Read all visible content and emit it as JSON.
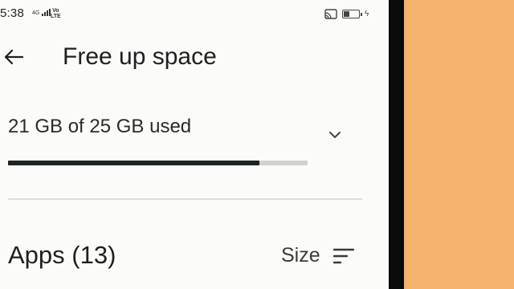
{
  "status_bar": {
    "time": "5:38",
    "network": "4G",
    "volte_line1": "Vo",
    "volte_line2": "LTE",
    "battery_level": 0.45
  },
  "app_bar": {
    "back_icon": "arrow-back-icon",
    "title": "Free up space"
  },
  "storage": {
    "summary": "21 GB of 25 GB used",
    "used_gb": 21,
    "total_gb": 25,
    "expand_icon": "chevron-down-icon"
  },
  "apps": {
    "title": "Apps (13)",
    "sort_label": "Size",
    "sort_icon": "sort-icon"
  },
  "colors": {
    "background": "#fbfcf9",
    "progress_fill": "#1e2321",
    "progress_track": "#cfd2d1",
    "side_panel": "#f4b36c"
  }
}
